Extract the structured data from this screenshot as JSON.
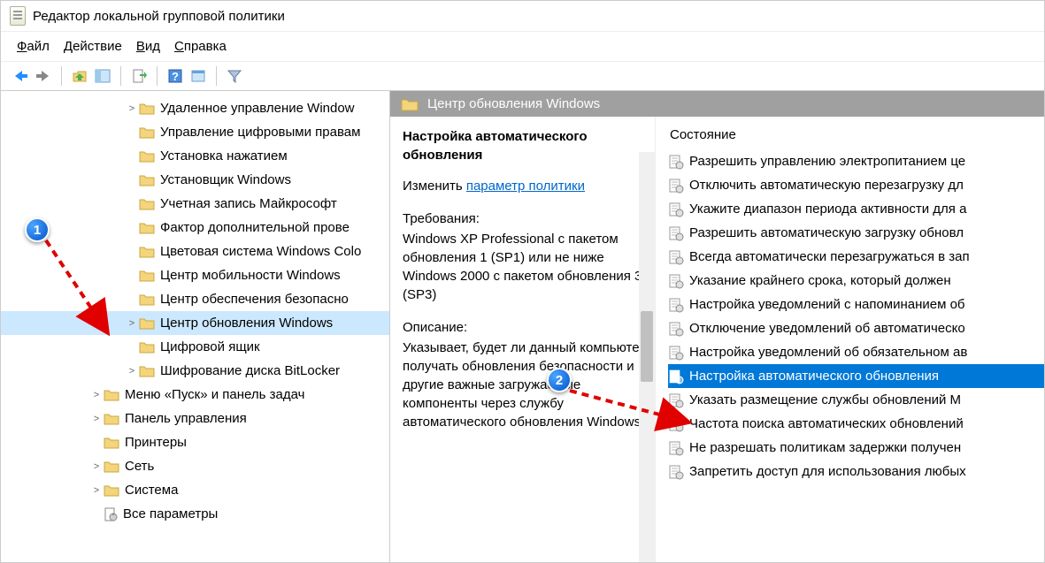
{
  "window": {
    "title": "Редактор локальной групповой политики"
  },
  "menu": {
    "file": "Файл",
    "action": "Действие",
    "view": "Вид",
    "help": "Справка"
  },
  "tree": {
    "items": [
      {
        "label": "Удаленное управление Window",
        "indent": "indent-2b",
        "expander": ">"
      },
      {
        "label": "Управление цифровыми правам",
        "indent": "indent-2b",
        "expander": ""
      },
      {
        "label": "Установка нажатием",
        "indent": "indent-2b",
        "expander": ""
      },
      {
        "label": "Установщик Windows",
        "indent": "indent-2b",
        "expander": ""
      },
      {
        "label": "Учетная запись Майкрософт",
        "indent": "indent-2b",
        "expander": ""
      },
      {
        "label": "Фактор дополнительной прове",
        "indent": "indent-2b",
        "expander": ""
      },
      {
        "label": "Цветовая система Windows Colo",
        "indent": "indent-2b",
        "expander": ""
      },
      {
        "label": "Центр мобильности Windows",
        "indent": "indent-2b",
        "expander": ""
      },
      {
        "label": "Центр обеспечения безопасно",
        "indent": "indent-2b",
        "expander": ""
      },
      {
        "label": "Центр обновления Windows",
        "indent": "indent-2b",
        "expander": ">",
        "selected": true
      },
      {
        "label": "Цифровой ящик",
        "indent": "indent-2b",
        "expander": ""
      },
      {
        "label": "Шифрование диска BitLocker",
        "indent": "indent-2b",
        "expander": ">"
      },
      {
        "label": "Меню «Пуск» и панель задач",
        "indent": "indent-1",
        "expander": ">"
      },
      {
        "label": "Панель управления",
        "indent": "indent-1",
        "expander": ">"
      },
      {
        "label": "Принтеры",
        "indent": "indent-1",
        "expander": ""
      },
      {
        "label": "Сеть",
        "indent": "indent-1",
        "expander": ">"
      },
      {
        "label": "Система",
        "indent": "indent-1",
        "expander": ">"
      },
      {
        "label": "Все параметры",
        "indent": "indent-1",
        "expander": "",
        "special": true
      }
    ]
  },
  "detail": {
    "header": "Центр обновления Windows",
    "policy_title": "Настройка автоматического обновления",
    "edit_prefix": "Изменить ",
    "edit_link": "параметр политики",
    "req_label": "Требования:",
    "req_text": "Windows XP Professional с пакетом обновления 1 (SP1) или не ниже Windows 2000 с пакетом обновления 3 (SP3)",
    "desc_label": "Описание:",
    "desc_text": "Указывает, будет ли данный компьютер получать обновления безопасности и другие важные загружаемые компоненты через службу автоматического обновления Windows."
  },
  "list": {
    "header": "Состояние",
    "items": [
      "Разрешить управлению электропитанием це",
      "Отключить автоматическую перезагрузку дл",
      "Укажите диапазон периода активности для а",
      "Разрешить автоматическую загрузку обновл",
      "Всегда автоматически перезагружаться в зап",
      "Указание крайнего срока, который должен",
      "Настройка уведомлений с напоминанием об",
      "Отключение уведомлений об автоматическо",
      "Настройка уведомлений об обязательном ав"
    ],
    "selected_item": "Настройка автоматического обновления",
    "items_after": [
      "Указать размещение службы обновлений М",
      "Частота поиска автоматических обновлений",
      "Не разрешать политикам задержки получен",
      "Запретить доступ для использования любых"
    ]
  },
  "badges": {
    "b1": "1",
    "b2": "2"
  }
}
